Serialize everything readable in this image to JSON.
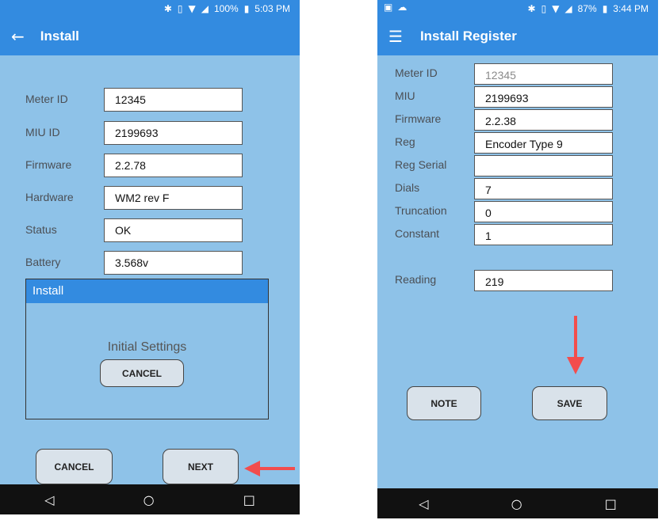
{
  "left_screen": {
    "status": {
      "battery": "100%",
      "time": "5:03 PM"
    },
    "title": "Install",
    "fields": [
      {
        "label": "Meter ID",
        "value": "12345"
      },
      {
        "label": "MIU ID",
        "value": "2199693"
      },
      {
        "label": "Firmware",
        "value": "2.2.78"
      },
      {
        "label": "Hardware",
        "value": "WM2 rev F"
      },
      {
        "label": "Status",
        "value": "OK"
      },
      {
        "label": "Battery",
        "value": "3.568v"
      }
    ],
    "dialog": {
      "title": "Install",
      "message": "Initial Settings",
      "cancel_label": "CANCEL"
    },
    "buttons": {
      "cancel": "CANCEL",
      "next": "NEXT"
    }
  },
  "right_screen": {
    "status": {
      "battery": "87%",
      "time": "3:44 PM"
    },
    "title": "Install Register",
    "fields": [
      {
        "label": "Meter ID",
        "value": "12345"
      },
      {
        "label": "MIU",
        "value": "2199693"
      },
      {
        "label": "Firmware",
        "value": "2.2.38"
      },
      {
        "label": "Reg",
        "value": "Encoder Type 9"
      },
      {
        "label": "Reg Serial",
        "value": ""
      },
      {
        "label": "Dials",
        "value": "7"
      },
      {
        "label": "Truncation",
        "value": "0"
      },
      {
        "label": "Constant",
        "value": "1"
      }
    ],
    "reading": {
      "label": "Reading",
      "value": "219"
    },
    "buttons": {
      "note": "NOTE",
      "save": "SAVE"
    }
  },
  "colors": {
    "appbar": "#338be0",
    "background": "#8ec2e8",
    "arrow": "#f24d4d",
    "navbar": "#111111"
  },
  "icons": [
    "back-arrow-icon",
    "menu-icon",
    "bluetooth-icon",
    "vibrate-icon",
    "wifi-icon",
    "signal-icon",
    "battery-icon",
    "image-icon",
    "cloud-icon",
    "nav-back-icon",
    "nav-home-icon",
    "nav-recents-icon",
    "pointer-arrow-icon"
  ]
}
